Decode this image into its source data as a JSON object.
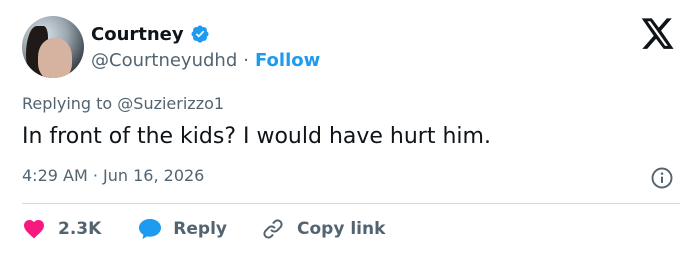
{
  "author": {
    "display_name": "Courtney",
    "handle": "@Courtneyudhd",
    "separator": "·",
    "follow_label": "Follow"
  },
  "tweet": {
    "replying_to": "Replying to @Suzierizzo1",
    "text": "In front of the kids? I would have hurt him.",
    "timestamp": "4:29 AM · Jun 16, 2026"
  },
  "actions": {
    "like_count": "2.3K",
    "reply_label": "Reply",
    "copy_link_label": "Copy link"
  },
  "icons": {
    "verified": "verified-badge-icon",
    "logo": "x-logo-icon",
    "info": "info-icon",
    "like": "heart-icon",
    "reply": "speech-bubble-icon",
    "copy_link": "link-icon"
  },
  "colors": {
    "accent_blue": "#1d9bf0",
    "like_red": "#f91880",
    "secondary_text": "#536471",
    "primary_text": "#0f1419",
    "divider": "#cfd9de"
  }
}
